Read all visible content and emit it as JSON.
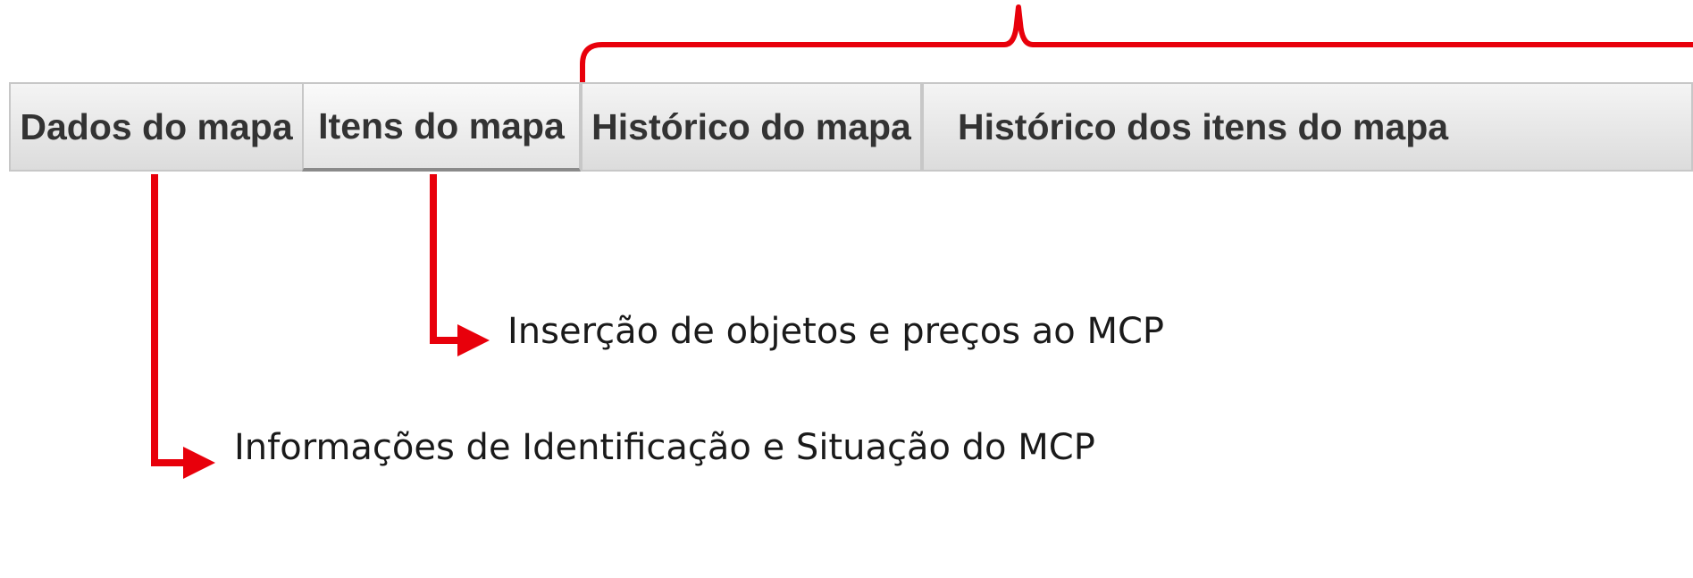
{
  "tabs": [
    {
      "label": "Dados do mapa"
    },
    {
      "label": "Itens do mapa"
    },
    {
      "label": "Histórico do mapa"
    },
    {
      "label": "Histórico dos itens do mapa"
    }
  ],
  "annotations": {
    "itens": "Inserção de objetos e preços ao MCP",
    "dados": "Informações de Identificação e Situação do MCP"
  },
  "colors": {
    "annotation_red": "#e8000b",
    "tab_text": "#333333"
  }
}
